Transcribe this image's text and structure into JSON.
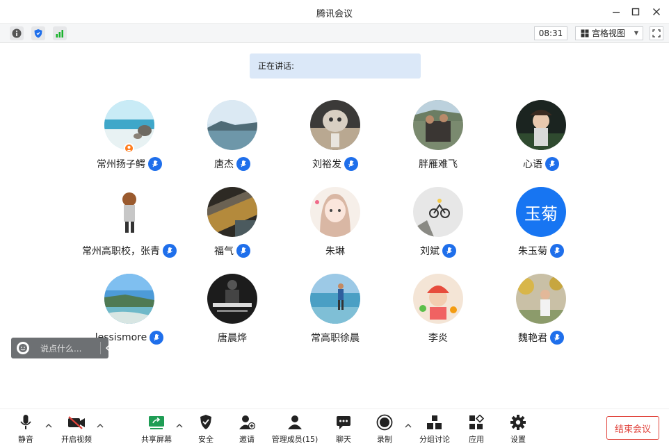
{
  "window": {
    "title": "腾讯会议"
  },
  "infobar": {
    "timer": "08:31",
    "view_label": "宫格视图"
  },
  "speaking": {
    "label": "正在讲话:"
  },
  "participants": [
    {
      "name": "常州扬子鳄",
      "mic": true,
      "host": true
    },
    {
      "name": "唐杰",
      "mic": true,
      "host": false
    },
    {
      "name": "刘裕发",
      "mic": true,
      "host": false
    },
    {
      "name": "胖雁难飞",
      "mic": false,
      "host": false
    },
    {
      "name": "心语",
      "mic": true,
      "host": false
    },
    {
      "name": "常州高职校，张青",
      "mic": true,
      "host": false
    },
    {
      "name": "福气",
      "mic": true,
      "host": false
    },
    {
      "name": "朱琳",
      "mic": false,
      "host": false
    },
    {
      "name": "刘斌",
      "mic": true,
      "host": false
    },
    {
      "name": "朱玉菊",
      "mic": true,
      "host": false,
      "avatar_text": "玉菊"
    },
    {
      "name": "lessismore",
      "mic": true,
      "host": false
    },
    {
      "name": "唐晨烨",
      "mic": false,
      "host": false
    },
    {
      "name": "常高职徐晨",
      "mic": false,
      "host": false
    },
    {
      "name": "李炎",
      "mic": false,
      "host": false
    },
    {
      "name": "魏艳君",
      "mic": true,
      "host": false
    }
  ],
  "chat": {
    "placeholder": "说点什么..."
  },
  "toolbar": {
    "mute": "静音",
    "video": "开启视频",
    "share": "共享屏幕",
    "security": "安全",
    "invite": "邀请",
    "members": "管理成员(15)",
    "chat": "聊天",
    "record": "录制",
    "breakout": "分组讨论",
    "apps": "应用",
    "settings": "设置",
    "end": "结束会议"
  },
  "colors": {
    "accent": "#1f6feb",
    "end": "#e0433b",
    "host_badge": "#ff7e1f",
    "banner": "#dbe8f8"
  }
}
